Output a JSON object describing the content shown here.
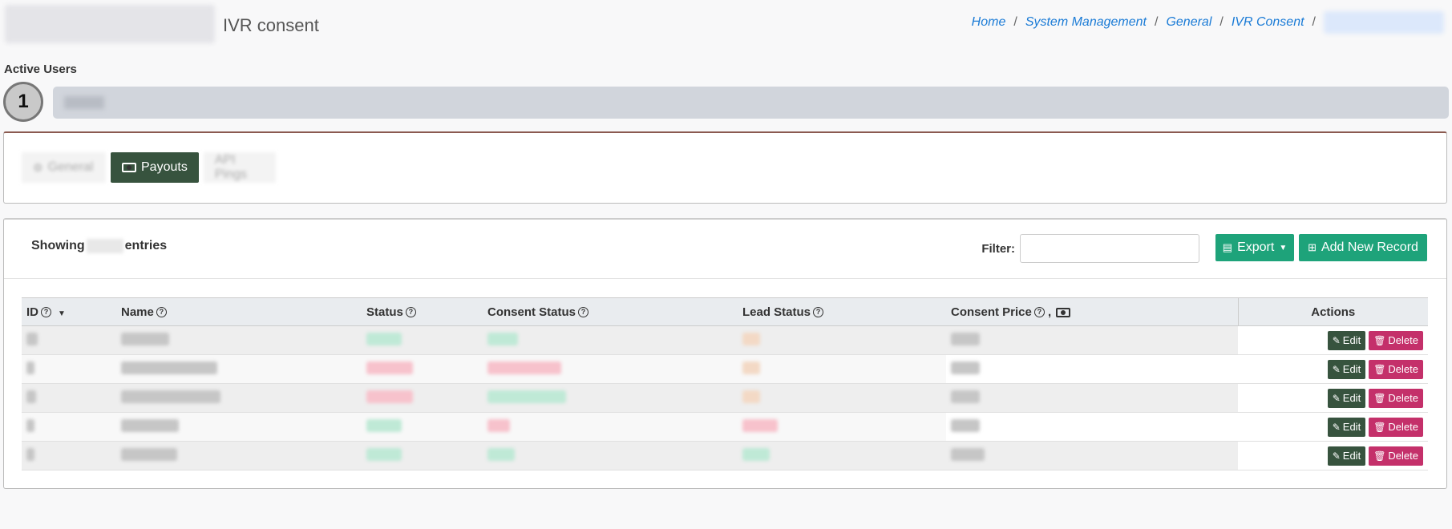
{
  "header": {
    "title": "IVR consent",
    "breadcrumb": [
      "Home",
      "System Management",
      "General",
      "IVR Consent"
    ]
  },
  "active_users": {
    "label": "Active Users",
    "count": "1"
  },
  "tabs": [
    {
      "label": "General",
      "icon": "gear-icon",
      "active": false
    },
    {
      "label": "Payouts",
      "icon": "money-icon",
      "active": true
    },
    {
      "label": "API Pings",
      "icon": "",
      "active": false
    }
  ],
  "toolbar": {
    "showing_prefix": "Showing",
    "showing_suffix": "entries",
    "filter_label": "Filter:",
    "filter_value": "",
    "export_label": "Export",
    "add_label": "Add New Record"
  },
  "table": {
    "columns": [
      "ID",
      "Name",
      "Status",
      "Consent Status",
      "Lead Status",
      "Consent Price",
      "Actions"
    ],
    "price_separator": ",",
    "edit_label": "Edit",
    "delete_label": "Delete",
    "rows": [
      {
        "status_color": "green",
        "consent_color": "green",
        "lead_color": "orange"
      },
      {
        "status_color": "red",
        "consent_color": "red",
        "lead_color": "orange"
      },
      {
        "status_color": "red",
        "consent_color": "green",
        "lead_color": "orange"
      },
      {
        "status_color": "green",
        "consent_color": "red",
        "lead_color": "red"
      },
      {
        "status_color": "green",
        "consent_color": "green",
        "lead_color": "green"
      }
    ]
  },
  "colors": {
    "primary_dark": "#37533e",
    "success": "#1ea37a",
    "danger": "#c4306a",
    "link": "#1a7bd6"
  }
}
